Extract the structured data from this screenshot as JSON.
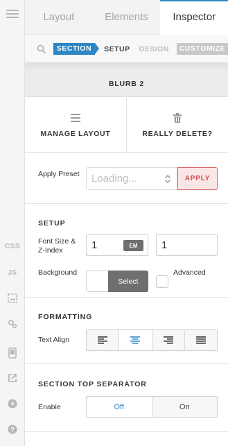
{
  "rail": {
    "items": [
      {
        "name": "menu-icon"
      },
      {
        "name": "css-button",
        "label": "CSS"
      },
      {
        "name": "js-button",
        "label": "JS"
      },
      {
        "name": "image-icon"
      },
      {
        "name": "settings-icon"
      },
      {
        "name": "mobile-preview-icon"
      },
      {
        "name": "external-link-icon"
      },
      {
        "name": "back-icon"
      },
      {
        "name": "help-icon"
      }
    ]
  },
  "tabs": [
    {
      "label": "Layout",
      "active": false
    },
    {
      "label": "Elements",
      "active": false
    },
    {
      "label": "Inspector",
      "active": true
    }
  ],
  "breadcrumb": {
    "section": "SECTION",
    "setup": "SETUP",
    "design": "DESIGN",
    "customize": "CUSTOMIZE"
  },
  "element": {
    "title": "BLURB 2"
  },
  "actions": {
    "manage_layout": "MANAGE LAYOUT",
    "really_delete": "REALLY DELETE?"
  },
  "preset": {
    "label": "Apply Preset",
    "select_value": "Loading...",
    "apply_label": "APPLY"
  },
  "setup": {
    "title": "SETUP",
    "font_size_label": "Font Size & Z-Index",
    "font_size_value": "1",
    "font_unit": "EM",
    "z_index_value": "1",
    "background_label": "Background",
    "select_label": "Select",
    "advanced_label": "Advanced"
  },
  "formatting": {
    "title": "FORMATTING",
    "text_align_label": "Text Align",
    "options": [
      "align-left",
      "align-center",
      "align-right",
      "align-justify"
    ],
    "active": "align-center"
  },
  "separator": {
    "title": "SECTION TOP SEPARATOR",
    "enable_label": "Enable",
    "off_label": "Off",
    "on_label": "On",
    "active": "Off"
  },
  "colors": {
    "accent": "#2c86c4",
    "danger": "#cc4a4a",
    "dark_button": "#6f6f6f"
  }
}
